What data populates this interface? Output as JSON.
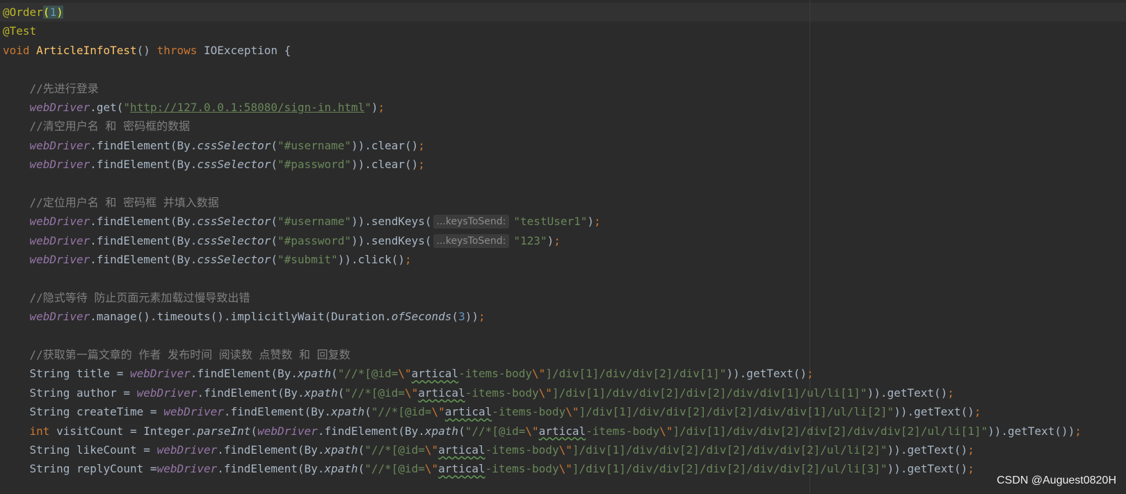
{
  "editor": {
    "lines": [
      [
        [
          "ann",
          "@Order"
        ],
        [
          "paren-hl",
          "("
        ],
        [
          "num-hl",
          "1"
        ],
        [
          "paren-hl",
          ")"
        ]
      ],
      [
        [
          "ann",
          "@Test"
        ]
      ],
      [
        [
          "kw",
          "void "
        ],
        [
          "fn",
          "ArticleInfoTest"
        ],
        [
          "plain",
          "() "
        ],
        [
          "kw",
          "throws "
        ],
        [
          "plain",
          "IOException {"
        ]
      ],
      [],
      [
        [
          "plain",
          "    "
        ],
        [
          "cmt",
          "//先进行登录"
        ]
      ],
      [
        [
          "plain",
          "    "
        ],
        [
          "field",
          "webDriver"
        ],
        [
          "plain",
          ".get("
        ],
        [
          "str",
          "\""
        ],
        [
          "url",
          "http://127.0.0.1:58080/sign-in.html"
        ],
        [
          "str",
          "\""
        ],
        [
          "plain",
          ")"
        ],
        [
          "semi",
          ";"
        ]
      ],
      [
        [
          "plain",
          "    "
        ],
        [
          "cmt",
          "//清空用户名 和 密码框的数据"
        ]
      ],
      [
        [
          "plain",
          "    "
        ],
        [
          "field",
          "webDriver"
        ],
        [
          "plain",
          ".findElement(By."
        ],
        [
          "static",
          "cssSelector"
        ],
        [
          "plain",
          "("
        ],
        [
          "str",
          "\"#username\""
        ],
        [
          "plain",
          "))."
        ],
        [
          "plain",
          "clear()"
        ],
        [
          "semi",
          ";"
        ]
      ],
      [
        [
          "plain",
          "    "
        ],
        [
          "field",
          "webDriver"
        ],
        [
          "plain",
          ".findElement(By."
        ],
        [
          "static",
          "cssSelector"
        ],
        [
          "plain",
          "("
        ],
        [
          "str",
          "\"#password\""
        ],
        [
          "plain",
          "))."
        ],
        [
          "plain",
          "clear()"
        ],
        [
          "semi",
          ";"
        ]
      ],
      [],
      [
        [
          "plain",
          "    "
        ],
        [
          "cmt",
          "//定位用户名 和 密码框 并填入数据"
        ]
      ],
      [
        [
          "plain",
          "    "
        ],
        [
          "field",
          "webDriver"
        ],
        [
          "plain",
          ".findElement(By."
        ],
        [
          "static",
          "cssSelector"
        ],
        [
          "plain",
          "("
        ],
        [
          "str",
          "\"#username\""
        ],
        [
          "plain",
          ")).sendKeys("
        ],
        [
          "hint",
          "...keysToSend:"
        ],
        [
          "str",
          "\"testUser1\""
        ],
        [
          "plain",
          ")"
        ],
        [
          "semi",
          ";"
        ]
      ],
      [
        [
          "plain",
          "    "
        ],
        [
          "field",
          "webDriver"
        ],
        [
          "plain",
          ".findElement(By."
        ],
        [
          "static",
          "cssSelector"
        ],
        [
          "plain",
          "("
        ],
        [
          "str",
          "\"#password\""
        ],
        [
          "plain",
          ")).sendKeys("
        ],
        [
          "hint",
          "...keysToSend:"
        ],
        [
          "str",
          "\"123\""
        ],
        [
          "plain",
          ")"
        ],
        [
          "semi",
          ";"
        ]
      ],
      [
        [
          "plain",
          "    "
        ],
        [
          "field",
          "webDriver"
        ],
        [
          "plain",
          ".findElement(By."
        ],
        [
          "static",
          "cssSelector"
        ],
        [
          "plain",
          "("
        ],
        [
          "str",
          "\"#submit\""
        ],
        [
          "plain",
          ")).click()"
        ],
        [
          "semi",
          ";"
        ]
      ],
      [],
      [
        [
          "plain",
          "    "
        ],
        [
          "cmt",
          "//隐式等待 防止页面元素加载过慢导致出错"
        ]
      ],
      [
        [
          "plain",
          "    "
        ],
        [
          "field",
          "webDriver"
        ],
        [
          "plain",
          ".manage().timeouts().implicitlyWait(Duration."
        ],
        [
          "static",
          "ofSeconds"
        ],
        [
          "plain",
          "("
        ],
        [
          "num",
          "3"
        ],
        [
          "plain",
          "))"
        ],
        [
          "semi",
          ";"
        ]
      ],
      [],
      [
        [
          "plain",
          "    "
        ],
        [
          "cmt",
          "//获取第一篇文章的 作者 发布时间 阅读数 点赞数 和 回复数"
        ]
      ],
      [
        [
          "plain",
          "    String title = "
        ],
        [
          "field",
          "webDriver"
        ],
        [
          "plain",
          ".findElement(By."
        ],
        [
          "static",
          "xpath"
        ],
        [
          "plain",
          "("
        ],
        [
          "str",
          "\"//*[@id="
        ],
        [
          "esc",
          "\\\""
        ],
        [
          "typo",
          "artical"
        ],
        [
          "str",
          "-items-body"
        ],
        [
          "esc",
          "\\\""
        ],
        [
          "str",
          "]/div[1]/div/div[2]/div[1]\""
        ],
        [
          "plain",
          ")).getText()"
        ],
        [
          "semi",
          ";"
        ]
      ],
      [
        [
          "plain",
          "    String author = "
        ],
        [
          "field",
          "webDriver"
        ],
        [
          "plain",
          ".findElement(By."
        ],
        [
          "static",
          "xpath"
        ],
        [
          "plain",
          "("
        ],
        [
          "str",
          "\"//*[@id="
        ],
        [
          "esc",
          "\\\""
        ],
        [
          "typo",
          "artical"
        ],
        [
          "str",
          "-items-body"
        ],
        [
          "esc",
          "\\\""
        ],
        [
          "str",
          "]/div[1]/div/div[2]/div[2]/div/div[1]/ul/li[1]\""
        ],
        [
          "plain",
          ")).getText()"
        ],
        [
          "semi",
          ";"
        ]
      ],
      [
        [
          "plain",
          "    String createTime = "
        ],
        [
          "field",
          "webDriver"
        ],
        [
          "plain",
          ".findElement(By."
        ],
        [
          "static",
          "xpath"
        ],
        [
          "plain",
          "("
        ],
        [
          "str",
          "\"//*[@id="
        ],
        [
          "esc",
          "\\\""
        ],
        [
          "typo",
          "artical"
        ],
        [
          "str",
          "-items-body"
        ],
        [
          "esc",
          "\\\""
        ],
        [
          "str",
          "]/div[1]/div/div[2]/div[2]/div/div[1]/ul/li[2]\""
        ],
        [
          "plain",
          ")).getText()"
        ],
        [
          "semi",
          ";"
        ]
      ],
      [
        [
          "plain",
          "    "
        ],
        [
          "kw",
          "int "
        ],
        [
          "plain",
          "visitCount = Integer."
        ],
        [
          "static",
          "parseInt"
        ],
        [
          "plain",
          "("
        ],
        [
          "field",
          "webDriver"
        ],
        [
          "plain",
          ".findElement(By."
        ],
        [
          "static",
          "xpath"
        ],
        [
          "plain",
          "("
        ],
        [
          "str",
          "\"//*[@id="
        ],
        [
          "esc",
          "\\\""
        ],
        [
          "typo",
          "artical"
        ],
        [
          "str",
          "-items-body"
        ],
        [
          "esc",
          "\\\""
        ],
        [
          "str",
          "]/div[1]/div/div[2]/div[2]/div/div[2]/ul/li[1]\""
        ],
        [
          "plain",
          ")).getText())"
        ],
        [
          "semi",
          ";"
        ]
      ],
      [
        [
          "plain",
          "    String likeCount = "
        ],
        [
          "field",
          "webDriver"
        ],
        [
          "plain",
          ".findElement(By."
        ],
        [
          "static",
          "xpath"
        ],
        [
          "plain",
          "("
        ],
        [
          "str",
          "\"//*[@id="
        ],
        [
          "esc",
          "\\\""
        ],
        [
          "typo",
          "artical"
        ],
        [
          "str",
          "-items-body"
        ],
        [
          "esc",
          "\\\""
        ],
        [
          "str",
          "]/div[1]/div/div[2]/div[2]/div/div[2]/ul/li[2]\""
        ],
        [
          "plain",
          ")).getText()"
        ],
        [
          "semi",
          ";"
        ]
      ],
      [
        [
          "plain",
          "    String replyCount ="
        ],
        [
          "field",
          "webDriver"
        ],
        [
          "plain",
          ".findElement(By."
        ],
        [
          "static",
          "xpath"
        ],
        [
          "plain",
          "("
        ],
        [
          "str",
          "\"//*[@id="
        ],
        [
          "esc",
          "\\\""
        ],
        [
          "typo",
          "artical"
        ],
        [
          "str",
          "-items-body"
        ],
        [
          "esc",
          "\\\""
        ],
        [
          "str",
          "]/div[1]/div/div[2]/div[2]/div/div[2]/ul/li[3]\""
        ],
        [
          "plain",
          ")).getText()"
        ],
        [
          "semi",
          ";"
        ]
      ]
    ]
  },
  "watermark": "CSDN @Auguest0820H"
}
